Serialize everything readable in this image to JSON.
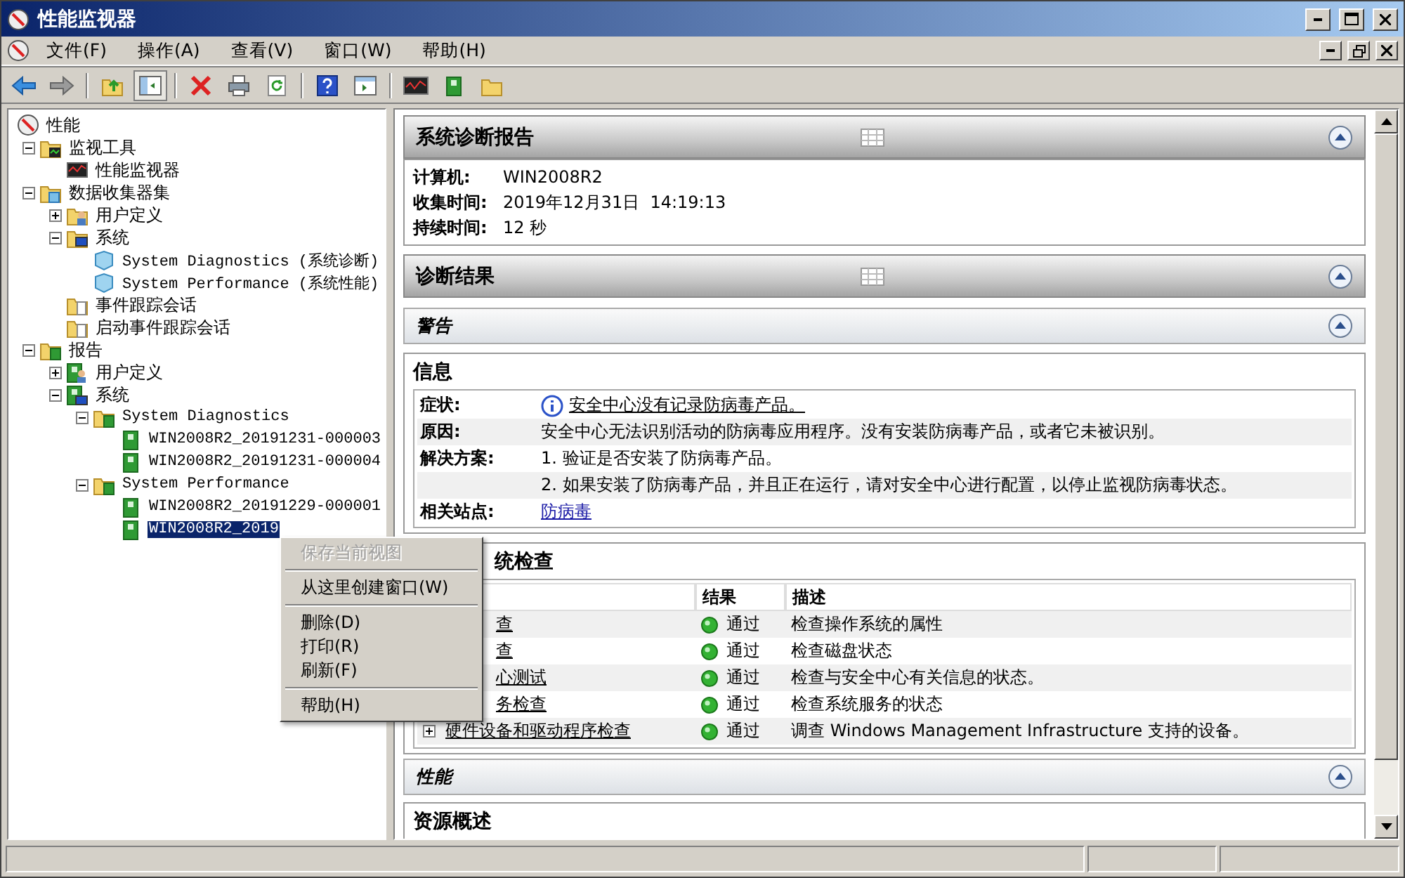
{
  "window": {
    "title": "性能监视器"
  },
  "menu_bar": [
    {
      "label": "文件(F)"
    },
    {
      "label": "操作(A)"
    },
    {
      "label": "查看(V)"
    },
    {
      "label": "窗口(W)"
    },
    {
      "label": "帮助(H)"
    }
  ],
  "tree": [
    {
      "label": "性能",
      "kind": "gauge",
      "selected": false,
      "children": [
        {
          "label": "监视工具",
          "kind": "monitor-folder",
          "expanded": true,
          "selected": false,
          "children": [
            {
              "label": "性能监视器",
              "kind": "monitor",
              "selected": false
            }
          ]
        },
        {
          "label": "数据收集器集",
          "kind": "data-folder",
          "expanded": true,
          "selected": false,
          "children": [
            {
              "label": "用户定义",
              "kind": "user-folder",
              "expanded": false,
              "selected": false
            },
            {
              "label": "系统",
              "kind": "system-folder",
              "expanded": true,
              "selected": false,
              "children": [
                {
                  "label": "System Diagnostics (系统诊断)",
                  "kind": "cube",
                  "mono": true,
                  "selected": false
                },
                {
                  "label": "System Performance (系统性能)",
                  "kind": "cube",
                  "mono": true,
                  "selected": false
                }
              ]
            },
            {
              "label": "事件跟踪会话",
              "kind": "trace-folder",
              "selected": false
            },
            {
              "label": "启动事件跟踪会话",
              "kind": "trace-folder",
              "selected": false
            }
          ]
        },
        {
          "label": "报告",
          "kind": "report-folder",
          "expanded": true,
          "selected": false,
          "children": [
            {
              "label": "用户定义",
              "kind": "user-report",
              "expanded": false,
              "selected": false
            },
            {
              "label": "系统",
              "kind": "system-report",
              "expanded": true,
              "selected": false,
              "children": [
                {
                  "label": "System Diagnostics",
                  "kind": "report-folder",
                  "mono": true,
                  "expanded": true,
                  "selected": false,
                  "children": [
                    {
                      "label": "WIN2008R2_20191231-000003",
                      "kind": "report",
                      "mono": true,
                      "selected": false
                    },
                    {
                      "label": "WIN2008R2_20191231-000004",
                      "kind": "report",
                      "mono": true,
                      "selected": false
                    }
                  ]
                },
                {
                  "label": "System Performance",
                  "kind": "report-folder",
                  "mono": true,
                  "expanded": true,
                  "selected": false,
                  "children": [
                    {
                      "label": "WIN2008R2_20191229-000001",
                      "kind": "report",
                      "mono": true,
                      "selected": false
                    },
                    {
                      "label": "WIN2008R2_2019",
                      "kind": "report",
                      "mono": true,
                      "selected": true
                    }
                  ]
                }
              ]
            }
          ]
        }
      ]
    }
  ],
  "context_menu": [
    {
      "kind": "item",
      "label": "保存当前视图",
      "disabled": true
    },
    {
      "kind": "separator"
    },
    {
      "kind": "item",
      "label": "从这里创建窗口(W)",
      "disabled": false
    },
    {
      "kind": "separator"
    },
    {
      "kind": "item",
      "label": "删除(D)",
      "disabled": false
    },
    {
      "kind": "item",
      "label": "打印(R)",
      "disabled": false
    },
    {
      "kind": "item",
      "label": "刷新(F)",
      "disabled": false
    },
    {
      "kind": "separator"
    },
    {
      "kind": "item",
      "label": "帮助(H)",
      "disabled": false
    }
  ],
  "report": {
    "title": "系统诊断报告",
    "details": [
      {
        "label": "计算机:",
        "value": "WIN2008R2"
      },
      {
        "label": "收集时间:",
        "value": "2019年12月31日  14:19:13"
      },
      {
        "label": "持续时间:",
        "value": "12 秒"
      }
    ],
    "results_title": "诊断结果",
    "warning_title": "警告",
    "info": {
      "title": "信息",
      "rows": [
        {
          "label": "症状:",
          "text": "安全中心没有记录防病毒产品。",
          "kind": "alert"
        },
        {
          "label": "原因:",
          "text": "安全中心无法识别活动的防病毒应用程序。没有安装防病毒产品，或者它未被识别。",
          "kind": "text"
        },
        {
          "label": "解决方案:",
          "text": "1. 验证是否安装了防病毒产品。",
          "kind": "text"
        },
        {
          "text": "2. 如果安装了防病毒产品，并且正在运行，请对安全中心进行配置，以停止监视防病毒状态。",
          "kind": "text"
        },
        {
          "label": "相关站点:",
          "text": "防病毒",
          "kind": "link"
        }
      ]
    },
    "checks": {
      "title": "统检查",
      "columns": [
        "结果",
        "描述"
      ],
      "rows": [
        {
          "name": "查",
          "result": "通过",
          "description": "检查操作系统的属性"
        },
        {
          "name": "查",
          "result": "通过",
          "description": "检查磁盘状态"
        },
        {
          "name": "心测试",
          "result": "通过",
          "description": "检查与安全中心有关信息的状态。"
        },
        {
          "name": "务检查",
          "result": "通过",
          "description": "检查系统服务的状态"
        },
        {
          "name": "硬件设备和驱动程序检查",
          "expanded": false,
          "result": "通过",
          "description": "调查  Windows Management Infrastructure 支持的设备。"
        }
      ]
    },
    "performance_title": "性能",
    "resources_title": "资源概述"
  }
}
